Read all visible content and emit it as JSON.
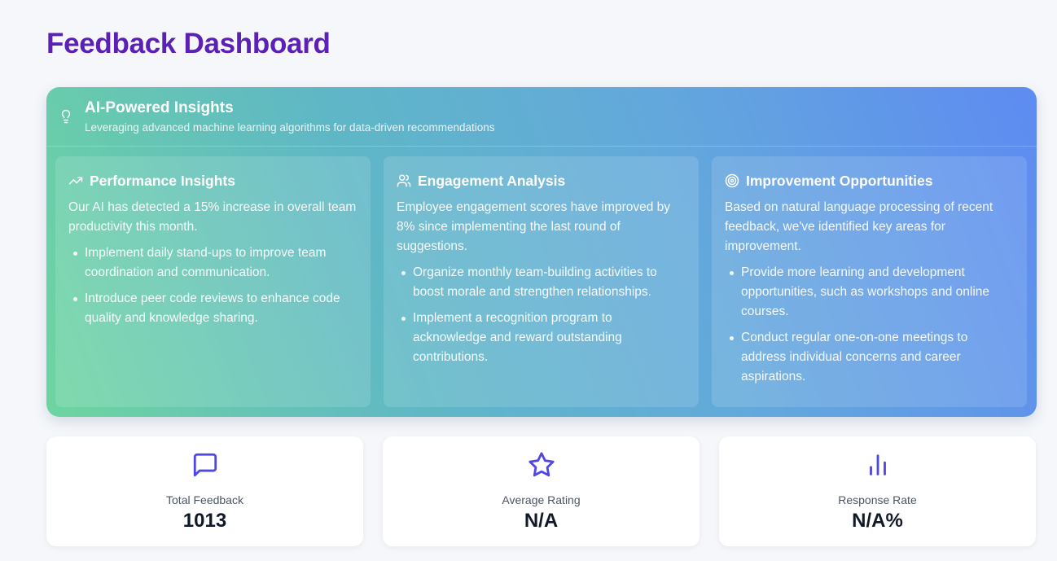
{
  "page": {
    "title": "Feedback Dashboard"
  },
  "insights": {
    "title": "AI-Powered Insights",
    "subtitle": "Leveraging advanced machine learning algorithms for data-driven recommendations",
    "icon": "lightbulb-icon",
    "cards": [
      {
        "icon": "trending-up-icon",
        "title": "Performance Insights",
        "body": "Our AI has detected a 15% increase in overall team productivity this month.",
        "items": [
          "Implement daily stand-ups to improve team coordination and communication.",
          "Introduce peer code reviews to enhance code quality and knowledge sharing."
        ]
      },
      {
        "icon": "users-icon",
        "title": "Engagement Analysis",
        "body": "Employee engagement scores have improved by 8% since implementing the last round of suggestions.",
        "items": [
          "Organize monthly team-building activities to boost morale and strengthen relationships.",
          "Implement a recognition program to acknowledge and reward outstanding contributions."
        ]
      },
      {
        "icon": "target-icon",
        "title": "Improvement Opportunities",
        "body": "Based on natural language processing of recent feedback, we've identified key areas for improvement.",
        "items": [
          "Provide more learning and development opportunities, such as workshops and online courses.",
          "Conduct regular one-on-one meetings to address individual concerns and career aspirations."
        ]
      }
    ]
  },
  "stats": [
    {
      "icon": "message-square-icon",
      "label": "Total Feedback",
      "value": "1013"
    },
    {
      "icon": "star-icon",
      "label": "Average Rating",
      "value": "N/A"
    },
    {
      "icon": "bar-chart-icon",
      "label": "Response Rate",
      "value": "N/A%"
    }
  ],
  "colors": {
    "title": "#5b21b6",
    "accent": "#5046e5",
    "gradient_start": "#6dd5a0",
    "gradient_end": "#5e8bf2"
  }
}
